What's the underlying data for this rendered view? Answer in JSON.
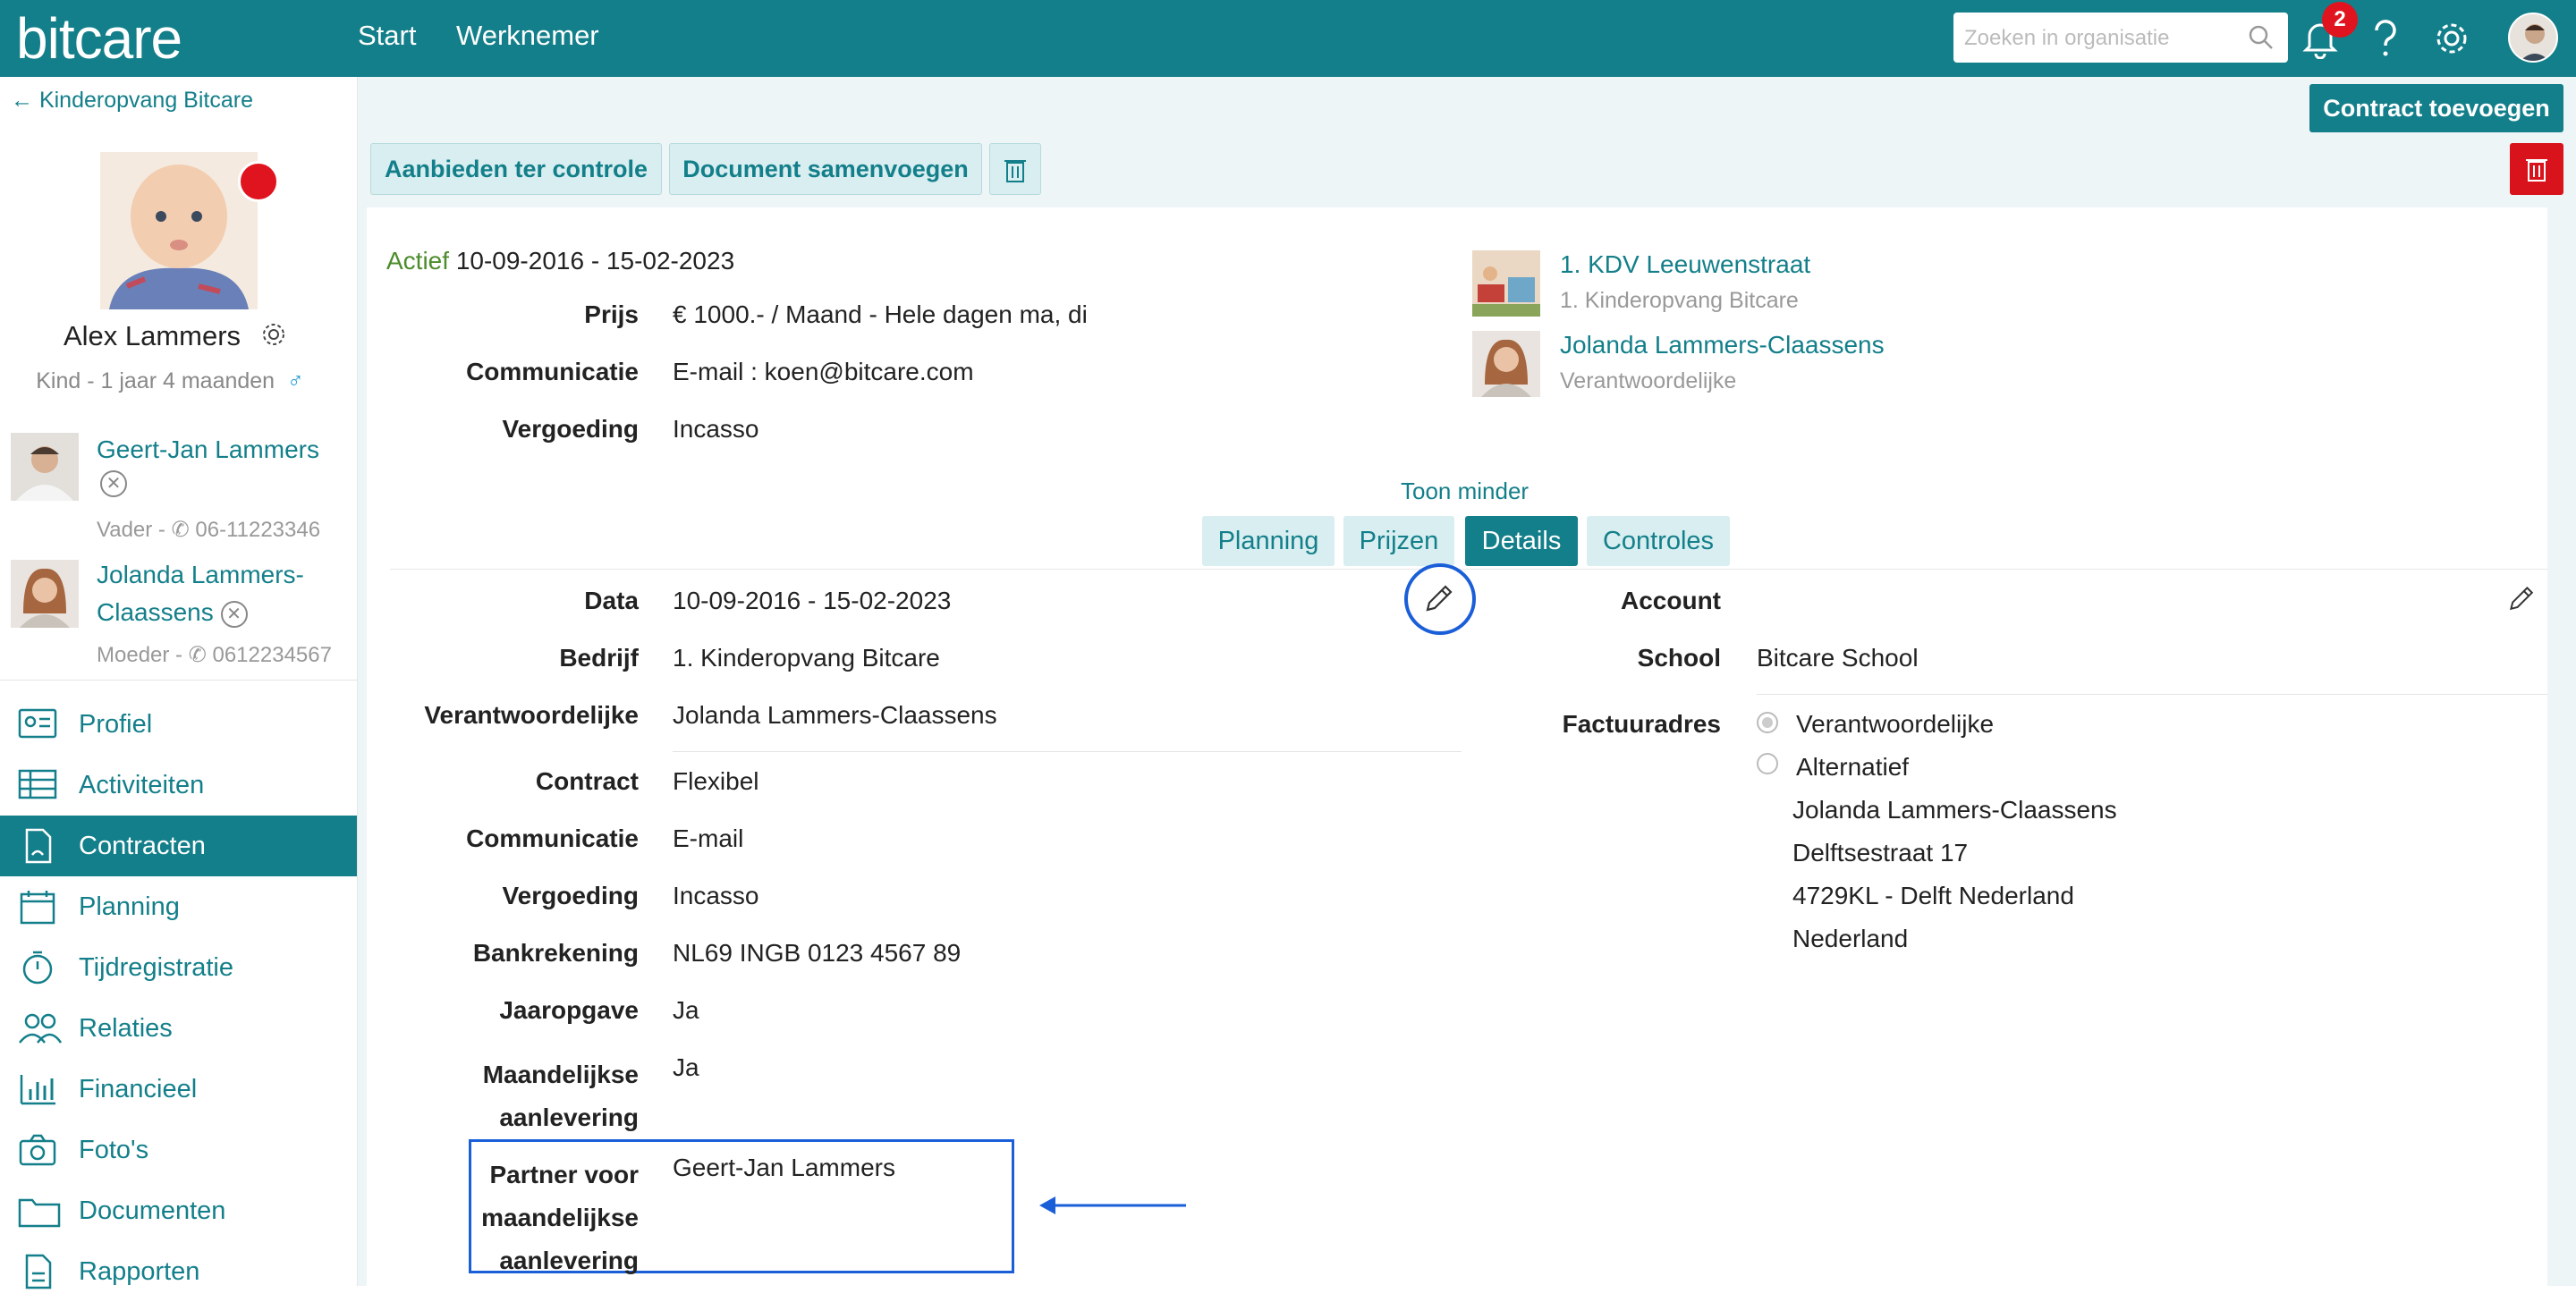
{
  "topbar": {
    "logo": "bitcare",
    "nav": [
      "Start",
      "Werknemer"
    ],
    "search_placeholder": "Zoeken in organisatie",
    "notification_count": "2",
    "accent_color": "#137f8a"
  },
  "sidebar": {
    "back_label": "Kinderopvang Bitcare",
    "child_name": "Alex Lammers",
    "child_sub": "Kind - 1 jaar 4 maanden",
    "relations": [
      {
        "name_line1": "Geert-Jan Lammers",
        "name_line2": "",
        "sub": "Vader - ",
        "phone": "06-11223346"
      },
      {
        "name_line1": "Jolanda Lammers-",
        "name_line2": "Claassens",
        "sub": "Moeder - ",
        "phone": "0612234567"
      }
    ],
    "menu": [
      {
        "label": "Profiel",
        "icon": "id-card-icon"
      },
      {
        "label": "Activiteiten",
        "icon": "table-icon"
      },
      {
        "label": "Contracten",
        "icon": "contract-icon"
      },
      {
        "label": "Planning",
        "icon": "calendar-icon"
      },
      {
        "label": "Tijdregistratie",
        "icon": "stopwatch-icon"
      },
      {
        "label": "Relaties",
        "icon": "people-icon"
      },
      {
        "label": "Financieel",
        "icon": "bar-chart-icon"
      },
      {
        "label": "Foto's",
        "icon": "camera-icon"
      },
      {
        "label": "Documenten",
        "icon": "folder-icon"
      },
      {
        "label": "Rapporten",
        "icon": "report-icon"
      }
    ]
  },
  "actions": {
    "add_contract": "Contract toevoegen",
    "offer_review": "Aanbieden ter controle",
    "merge_document": "Document samenvoegen"
  },
  "summary": {
    "status": "Actief",
    "period": "10-09-2016 - 15-02-2023",
    "rows": [
      {
        "label": "Prijs",
        "value": "€ 1000.- / Maand - Hele dagen ma, di"
      },
      {
        "label": "Communicatie",
        "value": "E-mail : koen@bitcare.com"
      },
      {
        "label": "Vergoeding",
        "value": "Incasso"
      }
    ],
    "location_name": "1. KDV Leeuwenstraat",
    "location_sub": "1. Kinderopvang Bitcare",
    "responsible_name": "Jolanda Lammers-Claassens",
    "responsible_sub": "Verantwoordelijke"
  },
  "toggle_less": "Toon minder",
  "tabs": [
    "Planning",
    "Prijzen",
    "Details",
    "Controles"
  ],
  "details": {
    "left": [
      {
        "label": "Data",
        "value": "10-09-2016 - 15-02-2023"
      },
      {
        "label": "Bedrijf",
        "value": "1. Kinderopvang Bitcare"
      },
      {
        "label": "Verantwoordelijke",
        "value": "Jolanda Lammers-Claassens"
      },
      {
        "label": "Contract",
        "value": "Flexibel"
      },
      {
        "label": "Communicatie",
        "value": "E-mail"
      },
      {
        "label": "Vergoeding",
        "value": "Incasso"
      },
      {
        "label": "Bankrekening",
        "value": "NL69 INGB 0123 4567 89"
      },
      {
        "label": "Jaaropgave",
        "value": "Ja"
      },
      {
        "label_line1": "Maandelijkse",
        "label_line2": "aanlevering",
        "value": "Ja"
      },
      {
        "label_line1": "Partner voor",
        "label_line2": "maandelijkse",
        "label_line3": "aanlevering",
        "value": "Geert-Jan Lammers"
      }
    ],
    "right": {
      "account_label": "Account",
      "account_value": "",
      "school_label": "School",
      "school_value": "Bitcare School",
      "billing_label": "Factuuradres",
      "option_1": "Verantwoordelijke",
      "option_2": "Alternatief",
      "address": [
        "Jolanda Lammers-Claassens",
        "Delftsestraat 17",
        "4729KL - Delft Nederland",
        "Nederland"
      ]
    }
  }
}
